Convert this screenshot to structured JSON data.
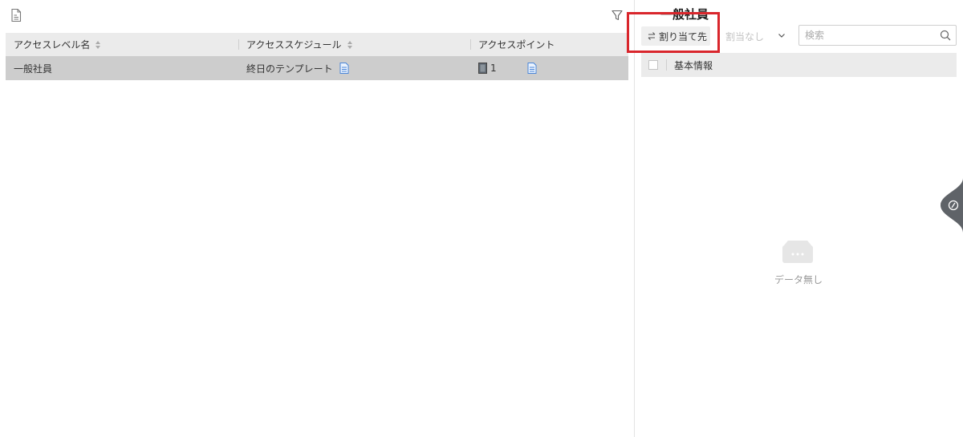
{
  "toolbar": {
    "export_icon": "export-icon",
    "filter_icon": "filter-icon"
  },
  "table": {
    "columns": [
      {
        "label": "アクセスレベル名",
        "sortable": true
      },
      {
        "label": "アクセススケジュール",
        "sortable": true
      },
      {
        "label": "アクセスポイント",
        "sortable": false
      }
    ],
    "rows": [
      {
        "name": "一般社員",
        "schedule": "終日のテンプレート",
        "access_point_count": "1"
      }
    ]
  },
  "right_panel": {
    "title": "一般社員",
    "assign_label": "割り当て先",
    "unassign_label": "割当なし",
    "search_placeholder": "検索",
    "column_basic_info": "基本情報",
    "empty_text": "データ無し"
  },
  "colors": {
    "highlight": "#d9262c",
    "doc_icon": "#4a86d9",
    "selected_row": "#cdcdcd"
  }
}
